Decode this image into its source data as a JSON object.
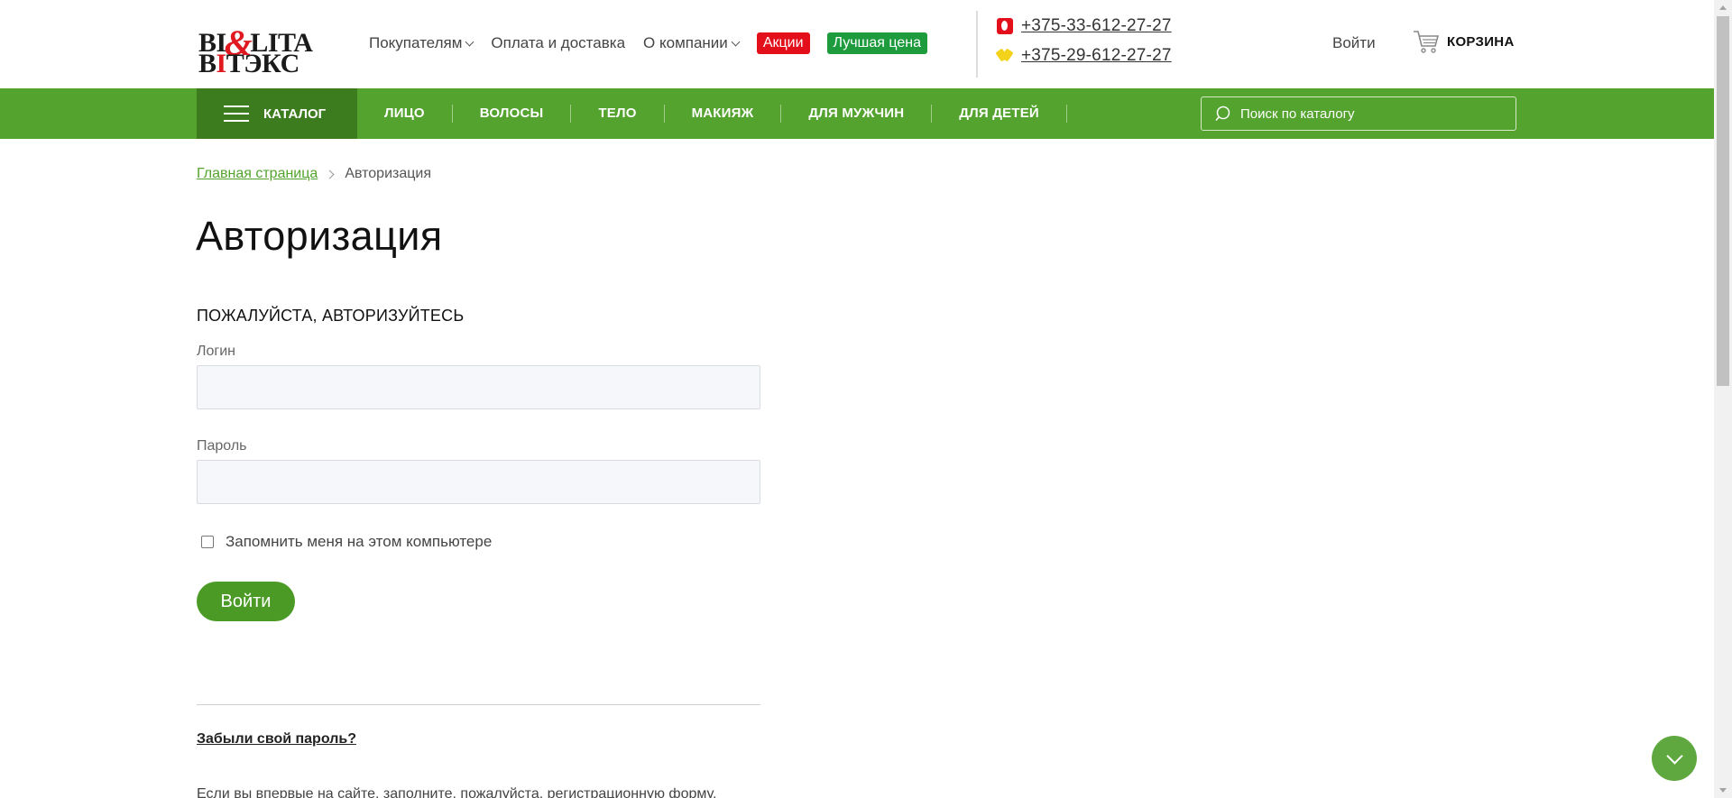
{
  "header": {
    "logo": {
      "line1_a": "BI",
      "line1_amp": "&",
      "line1_b": "LITA",
      "line2_a": "B",
      "line2_i": "I",
      "line2_b": "ТЭКС"
    },
    "nav": [
      {
        "label": "Покупателям",
        "dropdown": true
      },
      {
        "label": "Оплата и доставка",
        "dropdown": false
      },
      {
        "label": "О компании",
        "dropdown": true
      }
    ],
    "badges": [
      {
        "label": "Акции",
        "color": "#e3101b"
      },
      {
        "label": "Лучшая цена",
        "color": "#1d9b3d"
      }
    ],
    "phones": [
      {
        "operator": "mts-icon",
        "number": "+375-33-612-27-27"
      },
      {
        "operator": "a1-icon",
        "number": "+375-29-612-27-27"
      }
    ],
    "login_label": "Войти",
    "cart_label": "КОРЗИНА"
  },
  "menu": {
    "catalog_label": "КАТАЛОГ",
    "categories": [
      "ЛИЦО",
      "ВОЛОСЫ",
      "ТЕЛО",
      "МАКИЯЖ",
      "ДЛЯ МУЖЧИН",
      "ДЛЯ ДЕТЕЙ"
    ],
    "search_placeholder": "Поиск по каталогу",
    "accent_color": "#53a32e"
  },
  "breadcrumb": {
    "home": "Главная страница",
    "current": "Авторизация"
  },
  "page": {
    "title": "Авторизация",
    "subtitle": "ПОЖАЛУЙСТА, АВТОРИЗУЙТЕСЬ",
    "login_label": "Логин",
    "login_value": "",
    "password_label": "Пароль",
    "password_value": "",
    "remember_label": "Запомнить меня на этом компьютере",
    "remember_checked": false,
    "submit_label": "Войти",
    "forgot_label": "Забыли свой пароль?",
    "register_text": "Если вы впервые на сайте, заполните, пожалуйста, регистрационную форму."
  }
}
